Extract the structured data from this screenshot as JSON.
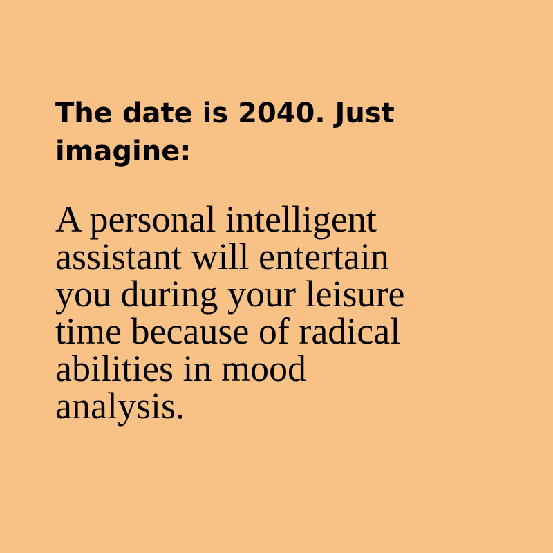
{
  "background_color": "#f8c185",
  "headline": {
    "lines": [
      "The date is 2040. Just",
      "imagine:"
    ]
  },
  "body": {
    "lines": [
      "A personal intelligent",
      "assistant will entertain",
      "you during your leisure",
      "time because of radical",
      "abilities in mood",
      "analysis."
    ]
  }
}
